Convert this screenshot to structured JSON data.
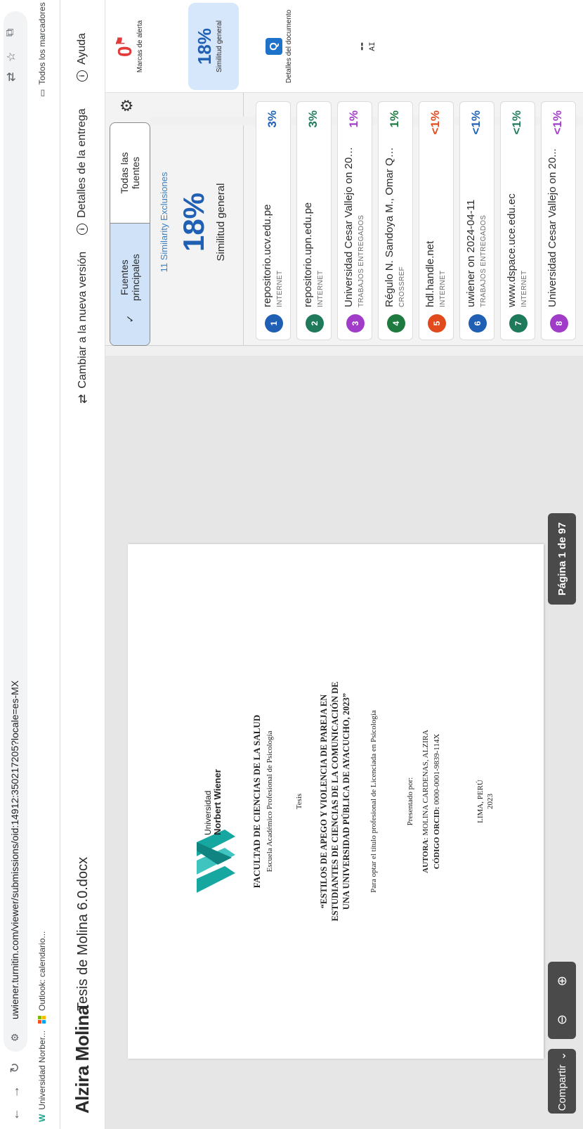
{
  "browser": {
    "url": "uwiener.turnitin.com/viewer/submissions/oid:14912:350217205?locale=es-MX",
    "bookmarks": [
      "Universidad Norber...",
      "Outlook: calendario...",
      "Todos los marcadores"
    ]
  },
  "header": {
    "brand": "Alzira Molina",
    "doc_title": "Tesis de Molina 6.0.docx",
    "switch_version": "Cambiar a la nueva versión",
    "submission_details": "Detalles de la entrega",
    "help": "Ayuda"
  },
  "document": {
    "uni_line1": "Universidad",
    "uni_line2": "Norbert Wiener",
    "faculty": "FACULTAD DE CIENCIAS DE LA SALUD",
    "school": "Escuela Académico Profesional de Psicología",
    "kind": "Tesis",
    "title_l1": "“ESTILOS DE APEGO Y VIOLENCIA DE PAREJA EN",
    "title_l2": "ESTUDIANTES DE CIENCIAS DE LA COMUNICACIÓN DE",
    "title_l3": "UNA UNIVERSIDAD PÚBLICA DE AYACUCHO, 2023”",
    "purpose": "Para optar el título profesional de Licenciada en Psicología",
    "presented_by": "Presentado por:",
    "author_label": "AUTORA",
    "author": ": MOLINA CARDENAS, ALZIRA",
    "orcid_label": "CÓDIGO ORCID:",
    "orcid": " 0000-0001-9839-114X",
    "city": "LIMA, PERÚ",
    "year": "2023"
  },
  "toolbar": {
    "share": "Compartir",
    "page_indicator": "Página 1 de 97"
  },
  "sidebar": {
    "tab_main": "Fuentes principales",
    "tab_all": "Todas las fuentes",
    "exclusions": "11 Similarity Exclusiones",
    "overall_pct": "18%",
    "overall_label": "Similitud general",
    "sources": [
      {
        "num": "1",
        "title": "repositorio.ucv.edu.pe",
        "type": "INTERNET",
        "pct": "3%",
        "color": "#1f5fb4"
      },
      {
        "num": "2",
        "title": "repositorio.upn.edu.pe",
        "type": "INTERNET",
        "pct": "3%",
        "color": "#1e7a5a"
      },
      {
        "num": "3",
        "title": "Universidad Cesar Vallejo on 2023...",
        "type": "TRABAJOS ENTREGADOS",
        "pct": "1%",
        "color": "#a13cc9"
      },
      {
        "num": "4",
        "title": "Régulo N. Sandoya M., Omar Quin...",
        "type": "CROSSREF",
        "pct": "1%",
        "color": "#1e7a3f"
      },
      {
        "num": "5",
        "title": "hdl.handle.net",
        "type": "INTERNET",
        "pct": "<1%",
        "color": "#e04a1c"
      },
      {
        "num": "6",
        "title": "uwiener on 2024-04-11",
        "type": "TRABAJOS ENTREGADOS",
        "pct": "<1%",
        "color": "#1f5fb4"
      },
      {
        "num": "7",
        "title": "www.dspace.uce.edu.ec",
        "type": "INTERNET",
        "pct": "<1%",
        "color": "#1e7a5a"
      },
      {
        "num": "8",
        "title": "Universidad Cesar Vallejo on 20...",
        "type": "",
        "pct": "<1%",
        "color": "#a13cc9"
      }
    ]
  },
  "rail": {
    "alerts_count": "0",
    "alerts_label": "Marcas de alerta",
    "similarity_pct": "18%",
    "similarity_label": "Similitud general",
    "details_label": "Detalles del documento",
    "ai_label": "AI",
    "ai_value": "--"
  }
}
